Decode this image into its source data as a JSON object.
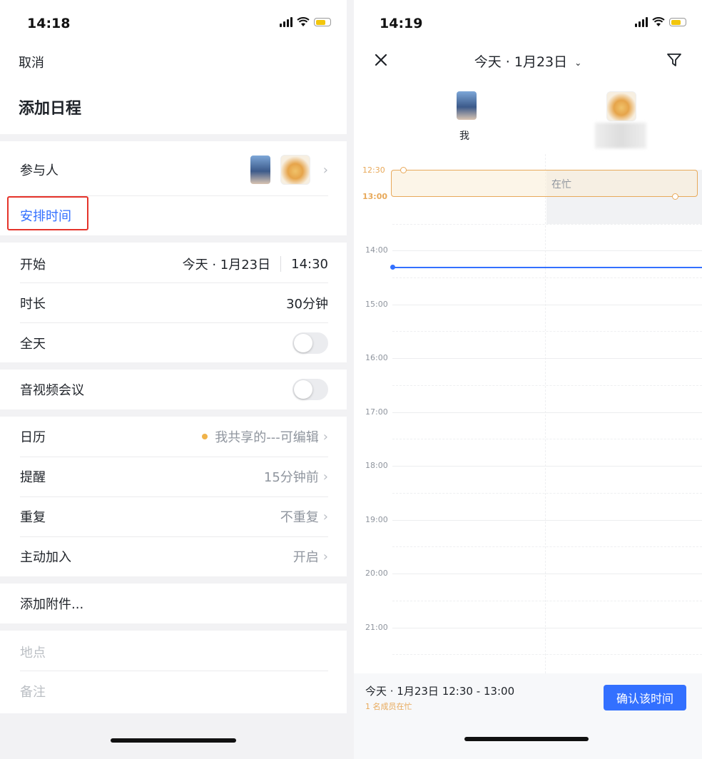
{
  "left": {
    "status_time": "14:18",
    "cancel": "取消",
    "title": "添加日程",
    "participants_label": "参与人",
    "schedule_time_link": "安排时间",
    "start_label": "开始",
    "start_date": "今天 · 1月23日",
    "start_time": "14:30",
    "duration_label": "时长",
    "duration_value": "30分钟",
    "allday_label": "全天",
    "video_label": "音视频会议",
    "calendar_label": "日历",
    "calendar_value": "我共享的---可编辑",
    "reminder_label": "提醒",
    "reminder_value": "15分钟前",
    "repeat_label": "重复",
    "repeat_value": "不重复",
    "join_label": "主动加入",
    "join_value": "开启",
    "attachment_label": "添加附件...",
    "location_placeholder": "地点",
    "notes_placeholder": "备注"
  },
  "right": {
    "status_time": "14:19",
    "date_title": "今天 · 1月23日",
    "me_label": "我",
    "busy_label": "在忙",
    "sel_start": "12:30",
    "sel_end": "13:00",
    "hours": [
      "14:00",
      "15:00",
      "16:00",
      "17:00",
      "18:00",
      "19:00",
      "20:00",
      "21:00"
    ],
    "footer_time": "今天 · 1月23日 12:30 - 13:00",
    "footer_busy": "1 名成员在忙",
    "confirm_button": "确认该时间"
  },
  "colors": {
    "accent": "#3370ff",
    "link": "#3370ff",
    "highlight_box": "#e5332a",
    "busy_orange": "#e8a95a",
    "calendar_dot": "#f0b34a"
  }
}
